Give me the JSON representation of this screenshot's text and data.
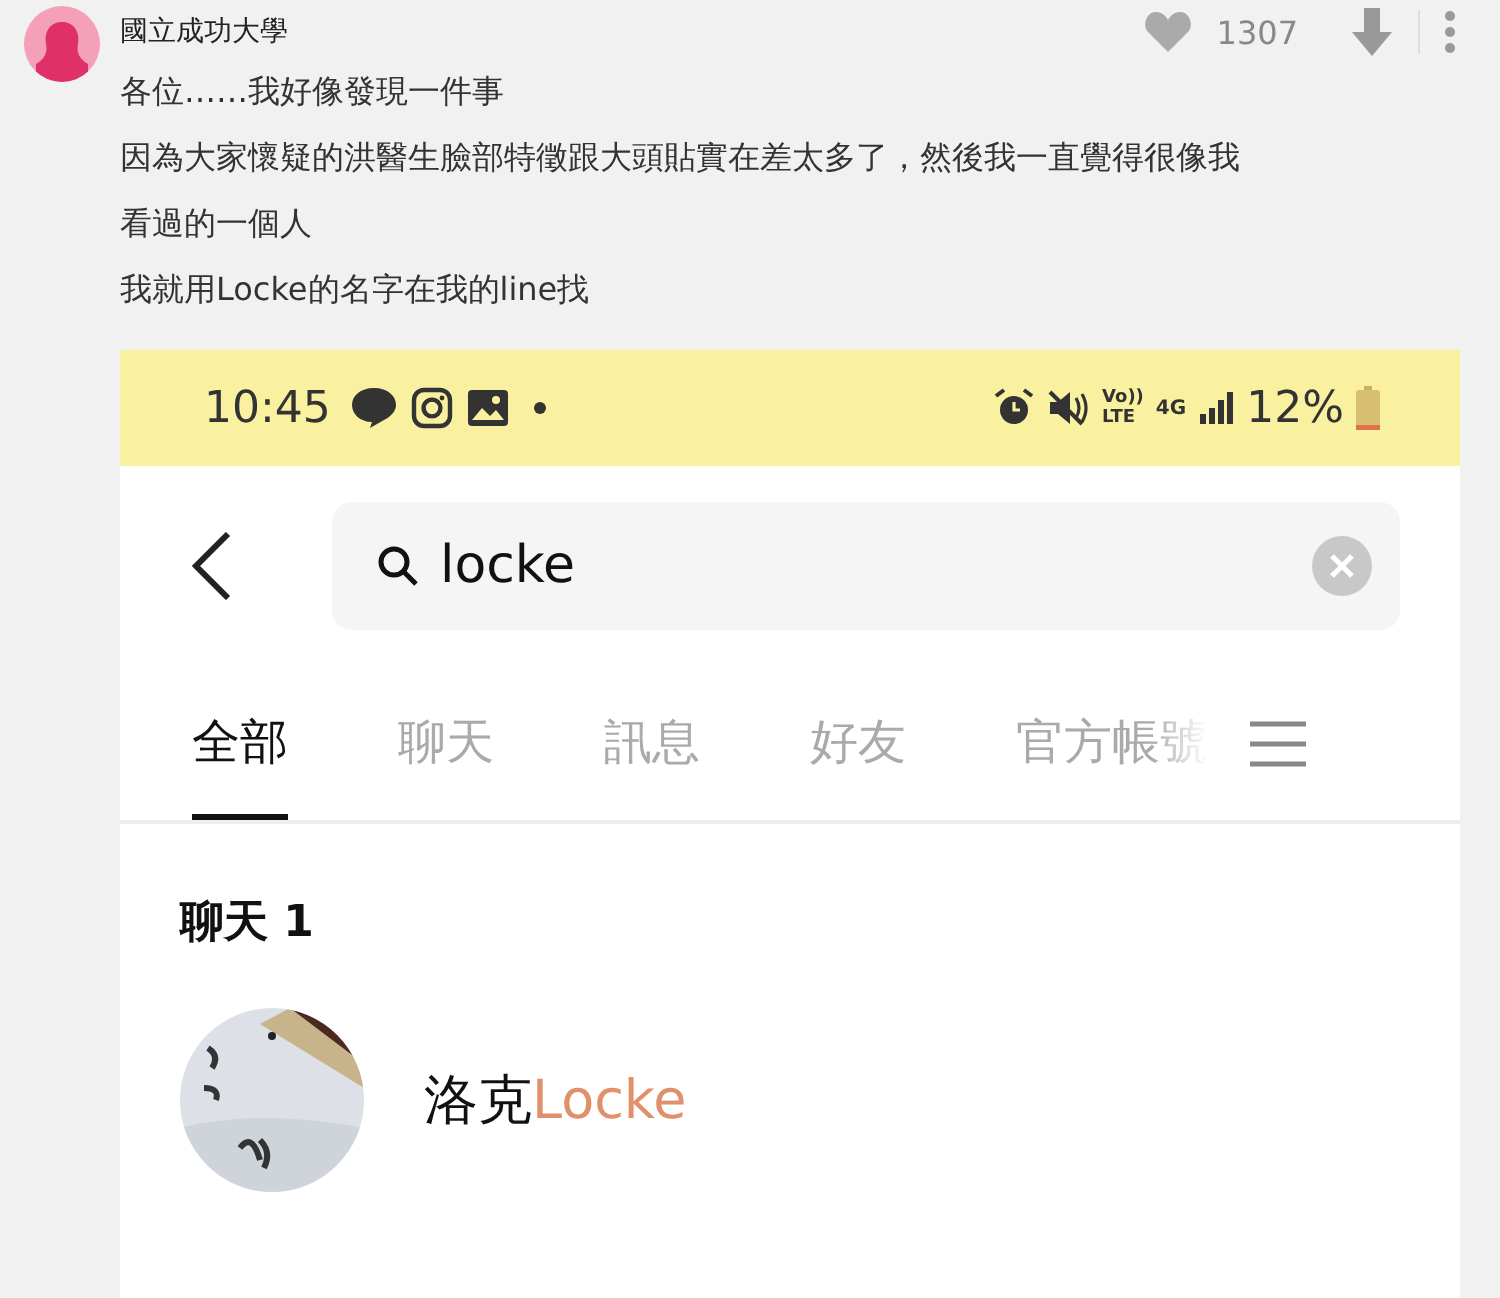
{
  "post": {
    "author": "國立成功大學",
    "likes": "1307",
    "lines": [
      "各位……我好像發現一件事",
      "因為大家懷疑的洪醫生臉部特徵跟大頭貼實在差太多了，然後我一直覺得很像我",
      "看過的一個人",
      "我就用Locke的名字在我的line找"
    ]
  },
  "screenshot": {
    "status_bar": {
      "time": "10:45",
      "volte": [
        "Vo))",
        "LTE"
      ],
      "network": "4G",
      "battery_text": "12%"
    },
    "search": {
      "value": "locke"
    },
    "tabs": [
      {
        "label": "全部",
        "selected": true
      },
      {
        "label": "聊天",
        "selected": false
      },
      {
        "label": "訊息",
        "selected": false
      },
      {
        "label": "好友",
        "selected": false
      },
      {
        "label": "官方帳號",
        "selected": false
      }
    ],
    "section_title": "聊天 1",
    "results": [
      {
        "name": [
          {
            "text": "洛克",
            "highlight": false
          },
          {
            "text": "Locke",
            "highlight": true
          }
        ]
      }
    ]
  }
}
